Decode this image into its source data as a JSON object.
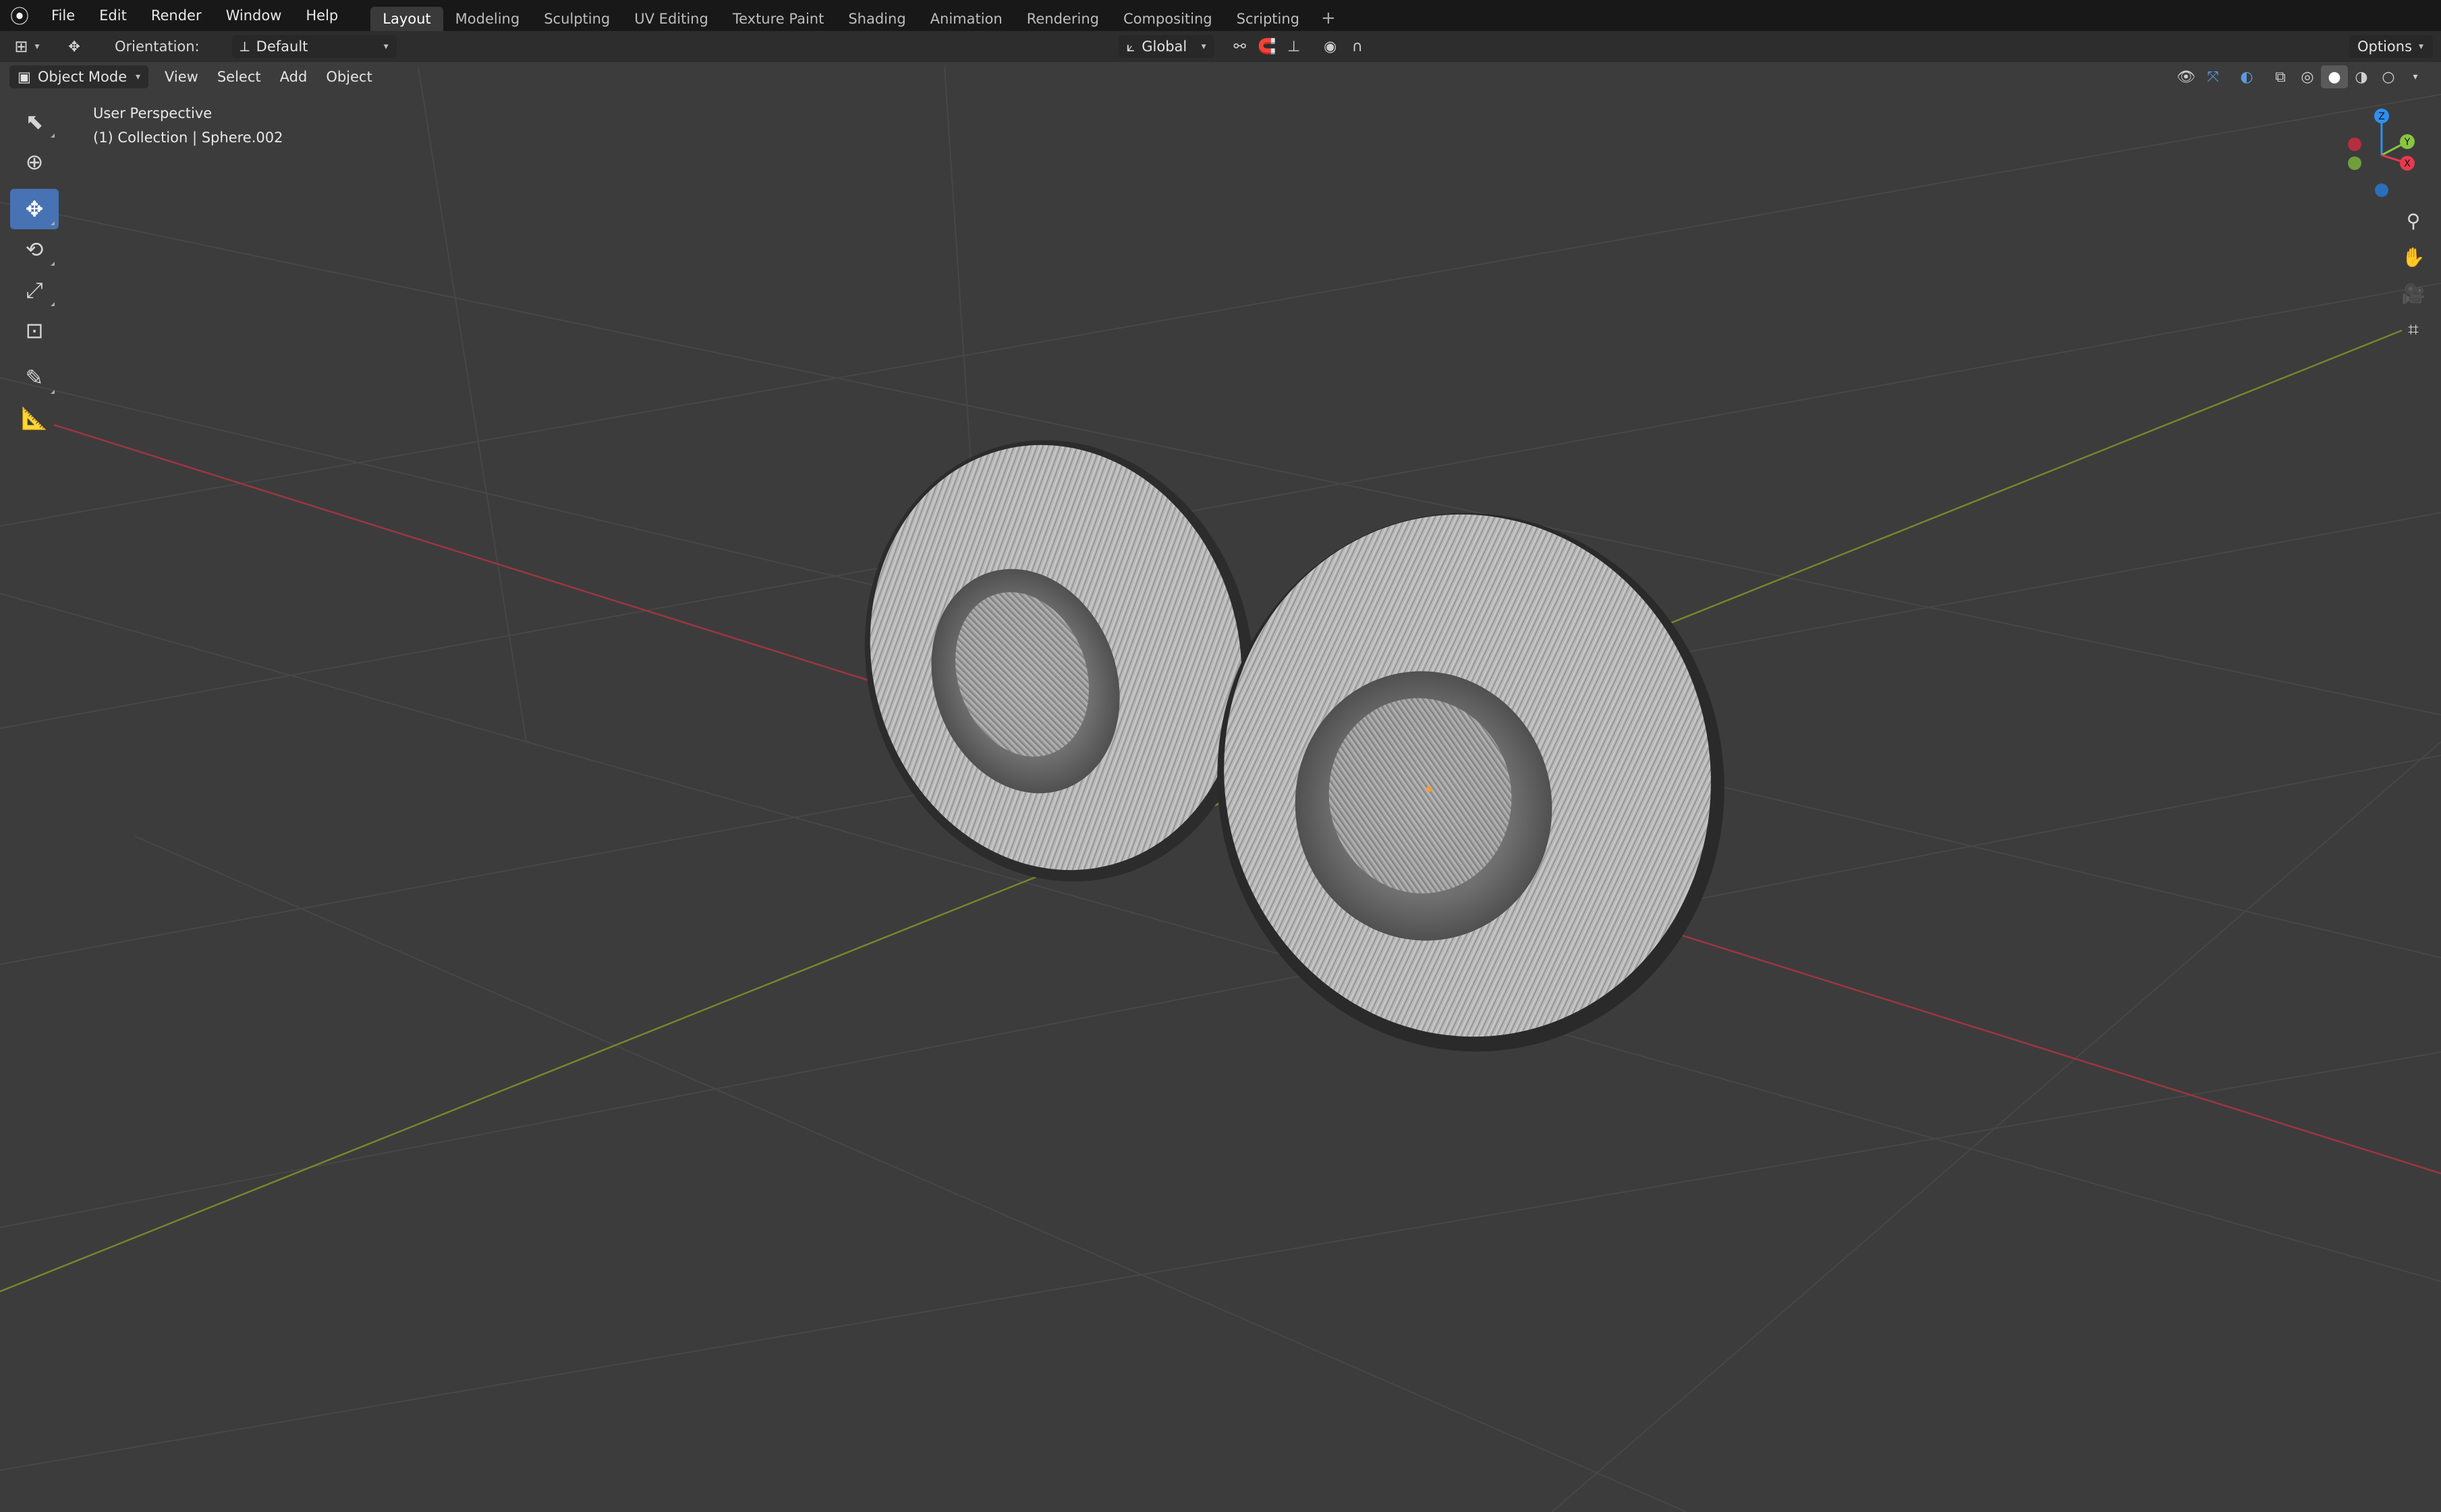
{
  "menubar": {
    "items": [
      "File",
      "Edit",
      "Render",
      "Window",
      "Help"
    ],
    "tabs": [
      "Layout",
      "Modeling",
      "Sculpting",
      "UV Editing",
      "Texture Paint",
      "Shading",
      "Animation",
      "Rendering",
      "Compositing",
      "Scripting"
    ],
    "active_tab": "Layout",
    "add_tab_label": "+"
  },
  "toolheader": {
    "orientation_label": "Orientation:",
    "orientation_value": "Default",
    "transform_space": "Global",
    "options_label": "Options"
  },
  "viewheader": {
    "mode": "Object Mode",
    "menus": [
      "View",
      "Select",
      "Add",
      "Object"
    ]
  },
  "overlay": {
    "view_name": "User Perspective",
    "object_info": "(1) Collection | Sphere.002"
  },
  "gizmo": {
    "x_label": "X",
    "y_label": "Y",
    "z_label": "Z",
    "x_color": "#e8394e",
    "y_color": "#88c540",
    "z_color": "#2f8ff1"
  },
  "colors": {
    "background": "#3c3c3c",
    "x_axis_line": "#9c3640",
    "y_axis_line": "#76862c",
    "active_tool": "#4772b3"
  },
  "toolbar": {
    "tools": [
      "select-box",
      "cursor",
      "move",
      "rotate",
      "scale",
      "transform",
      "annotate",
      "measure"
    ],
    "active_tool": "move"
  }
}
